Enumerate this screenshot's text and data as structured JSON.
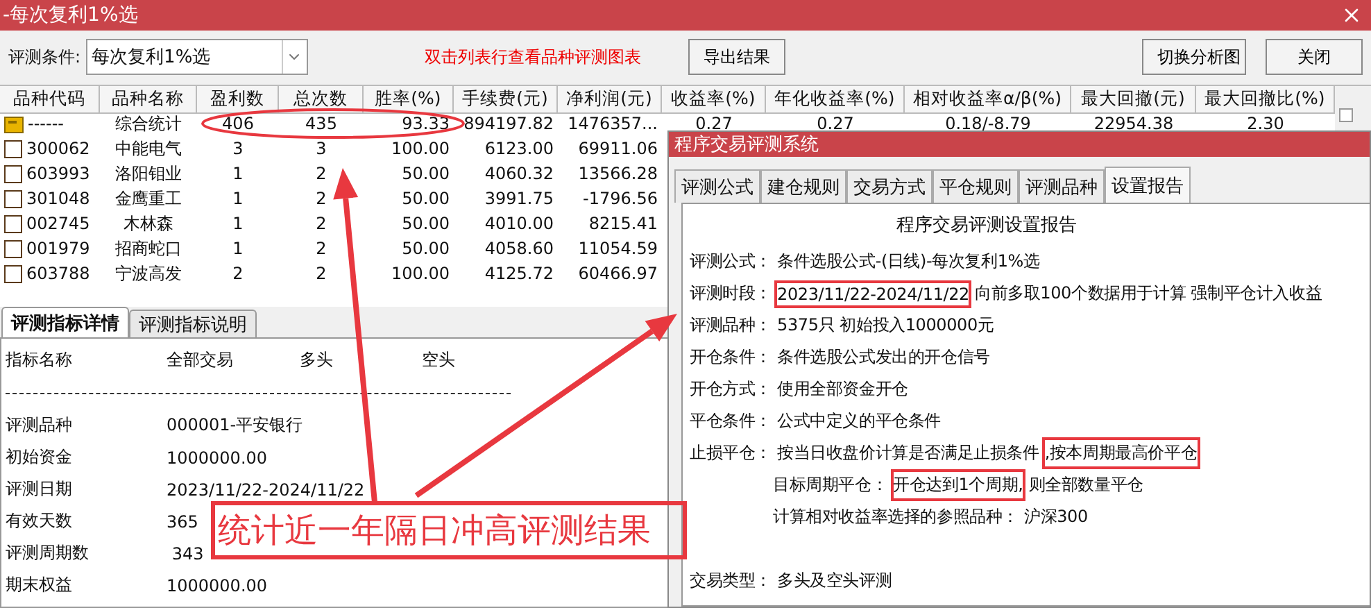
{
  "window": {
    "title": "-每次复利1%选"
  },
  "toolbar": {
    "condition_label": "评测条件:",
    "condition_value": "每次复利1%选",
    "hint": "双击列表行查看品种评测图表",
    "buttons": [
      "导出结果",
      "切换分析图",
      "关闭"
    ]
  },
  "table": {
    "columns": [
      "品种代码",
      "品种名称",
      "盈利数",
      "总次数",
      "胜率(%)",
      "手续费(元)",
      "净利润(元)",
      "收益率(%)",
      "年化收益率(%)",
      "相对收益率α/β(%)",
      "最大回撤(元)",
      "最大回撤比(%)"
    ],
    "rows": [
      {
        "kind": "summary",
        "cells": [
          "------",
          "综合统计",
          "406",
          "435",
          "93.33",
          "894197.82",
          "1476357...",
          "0.27",
          "0.27",
          "0.18/-8.79",
          "22954.38",
          "2.30"
        ]
      },
      {
        "kind": "item",
        "cells": [
          "300062",
          "中能电气",
          "3",
          "3",
          "100.00",
          "6123.00",
          "69911.06"
        ]
      },
      {
        "kind": "item",
        "cells": [
          "603993",
          "洛阳钼业",
          "1",
          "2",
          "50.00",
          "4060.32",
          "13566.28"
        ]
      },
      {
        "kind": "item",
        "cells": [
          "301048",
          "金鹰重工",
          "1",
          "2",
          "50.00",
          "3991.75",
          "-1796.56"
        ]
      },
      {
        "kind": "item",
        "cells": [
          "002745",
          "木林森",
          "1",
          "2",
          "50.00",
          "4010.00",
          "8215.41"
        ]
      },
      {
        "kind": "item",
        "cells": [
          "001979",
          "招商蛇口",
          "1",
          "2",
          "50.00",
          "4058.60",
          "11054.59"
        ]
      },
      {
        "kind": "item",
        "cells": [
          "603788",
          "宁波高发",
          "2",
          "2",
          "100.00",
          "4125.72",
          "60466.97"
        ]
      }
    ]
  },
  "detail_tabs": [
    {
      "label": "评测指标详情",
      "selected": true
    },
    {
      "label": "评测指标说明",
      "selected": false
    }
  ],
  "detail": {
    "headers": [
      "指标名称",
      "全部交易",
      "多头",
      "空头"
    ],
    "rows": [
      [
        "评测品种",
        "000001-平安银行"
      ],
      [
        "初始资金",
        "1000000.00"
      ],
      [
        "评测日期",
        "2023/11/22-2024/11/22"
      ],
      [
        "有效天数",
        "365"
      ],
      [
        "评测周期数",
        " 343"
      ],
      [
        "期末权益",
        "1000000.00"
      ]
    ]
  },
  "dialog": {
    "title": "程序交易评测系统",
    "tabs": [
      {
        "label": "评测公式",
        "selected": false
      },
      {
        "label": "建仓规则",
        "selected": false
      },
      {
        "label": "交易方式",
        "selected": false
      },
      {
        "label": "平仓规则",
        "selected": false
      },
      {
        "label": "评测品种",
        "selected": false
      },
      {
        "label": "设置报告",
        "selected": true
      }
    ],
    "report_title": "程序交易评测设置报告",
    "lines": [
      {
        "kind": "line",
        "label": "评测公式：",
        "segments": [
          {
            "text": "条件选股公式-(日线)-每次复利1%选",
            "boxed": false
          }
        ]
      },
      {
        "kind": "line",
        "label": "评测时段：",
        "segments": [
          {
            "text": "2023/11/22-2024/11/22",
            "boxed": true
          },
          {
            "text": "向前多取100个数据用于计算 强制平仓计入收益",
            "boxed": false
          }
        ]
      },
      {
        "kind": "line",
        "label": "评测品种：",
        "segments": [
          {
            "text": "5375只 初始投入1000000元",
            "boxed": false
          }
        ]
      },
      {
        "kind": "line",
        "label": "开仓条件：",
        "segments": [
          {
            "text": "条件选股公式发出的开仓信号",
            "boxed": false
          }
        ]
      },
      {
        "kind": "line",
        "label": "开仓方式：",
        "segments": [
          {
            "text": "使用全部资金开仓",
            "boxed": false
          }
        ]
      },
      {
        "kind": "line",
        "label": "平仓条件：",
        "segments": [
          {
            "text": "公式中定义的平仓条件",
            "boxed": false
          }
        ]
      },
      {
        "kind": "line",
        "label": "止损平仓：",
        "segments": [
          {
            "text": "按当日收盘价计算是否满足止损条件",
            "boxed": false
          },
          {
            "text": ",按本周期最高价平仓",
            "boxed": true
          }
        ]
      },
      {
        "kind": "sub",
        "label": "目标周期平仓：",
        "segments": [
          {
            "text": "开仓达到1个周期,",
            "boxed": true
          },
          {
            "text": "则全部数量平仓",
            "boxed": false
          }
        ]
      },
      {
        "kind": "sub",
        "label": "计算相对收益率选择的参照品种：",
        "segments": [
          {
            "text": "沪深300",
            "boxed": false
          }
        ]
      },
      {
        "kind": "gap"
      },
      {
        "kind": "line",
        "label": "交易类型：",
        "segments": [
          {
            "text": "多头及空头评测",
            "boxed": false
          }
        ]
      }
    ]
  },
  "annotation": {
    "caption": "统计近一年隔日冲高评测结果"
  }
}
